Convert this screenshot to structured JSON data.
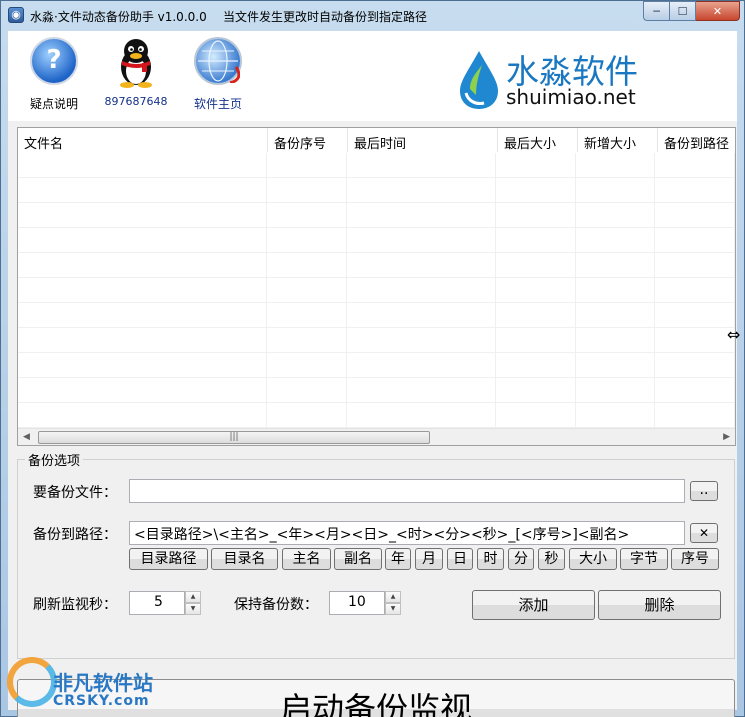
{
  "window": {
    "title": "水淼·文件动态备份助手 v1.0.0.0",
    "subtitle": "当文件发生更改时自动备份到指定路径",
    "min_glyph": "─",
    "max_glyph": "☐",
    "close_glyph": "✕"
  },
  "header": {
    "help_label": "疑点说明",
    "qq_label": "897687648",
    "home_label": "软件主页",
    "help_glyph": "?",
    "logo_cn": "水淼软件",
    "logo_en": "shuimiao.net"
  },
  "table": {
    "columns": [
      "文件名",
      "备份序号",
      "最后时间",
      "最后大小",
      "新增大小",
      "备份到路径"
    ],
    "rows": []
  },
  "options": {
    "group_title": "备份选项",
    "file_label": "要备份文件：",
    "file_value": "",
    "browse_label": "..",
    "path_label": "备份到路径：",
    "path_value": "<目录路径>\\<主名>_<年><月><日>_<时><分><秒>_[<序号>]<副名>",
    "clear_glyph": "✕",
    "tokens": [
      "目录路径",
      "目录名",
      "主名",
      "副名",
      "年",
      "月",
      "日",
      "时",
      "分",
      "秒",
      "大小",
      "字节",
      "序号"
    ],
    "refresh_label": "刷新监视秒：",
    "refresh_value": "5",
    "keep_label": "保持备份数：",
    "keep_value": "10",
    "add_label": "添加",
    "delete_label": "删除"
  },
  "start_label": "启动备份监视",
  "watermark": {
    "line1": "非凡软件站",
    "line2": "CRSKY.com"
  }
}
